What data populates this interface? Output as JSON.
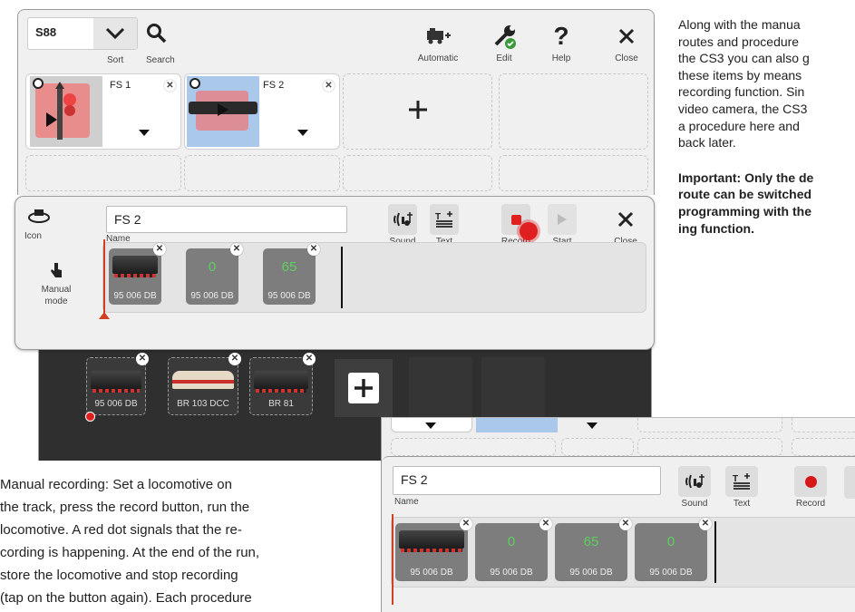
{
  "top_toolbar": {
    "s88_label": "S88",
    "sort_label": "Sort",
    "search_label": "Search",
    "automatic_label": "Automatic",
    "edit_label": "Edit",
    "help_label": "Help",
    "close_label": "Close"
  },
  "route_cards": [
    {
      "label": "FS 1"
    },
    {
      "label": "FS 2"
    }
  ],
  "editor": {
    "icon_label": "Icon",
    "name_value": "FS 2",
    "name_label": "Name",
    "sound_label": "Sound",
    "text_label": "Text",
    "record_label": "Record",
    "start_label": "Start",
    "close_label": "Close",
    "mode_label": "Manual mode",
    "steps": [
      {
        "caption": "95 006 DB",
        "value": ""
      },
      {
        "caption": "95 006 DB",
        "value": "0"
      },
      {
        "caption": "95 006 DB",
        "value": "65"
      }
    ]
  },
  "loco_list": [
    {
      "caption": "95 006 DB"
    },
    {
      "caption": "BR 103 DCC"
    },
    {
      "caption": "BR 81"
    }
  ],
  "zoom": {
    "name_value": "FS 2",
    "name_label": "Name",
    "sound_label": "Sound",
    "text_label": "Text",
    "record_label": "Record",
    "steps": [
      {
        "caption": "95 006 DB",
        "value": ""
      },
      {
        "caption": "95 006 DB",
        "value": "0"
      },
      {
        "caption": "95 006 DB",
        "value": "65"
      },
      {
        "caption": "95 006 DB",
        "value": "0"
      }
    ]
  },
  "text_right": {
    "para1": "Along with the manual routes and procedure the CS3 you can also g these items by means recording function. Sin video camera, the CS3 a procedure here and back later.",
    "lines1": [
      "Along with the manua",
      "routes and procedure",
      "the CS3 you can also g",
      "these items by means",
      "recording function. Sin",
      "video camera, the CS3",
      "a procedure here and",
      "back later."
    ],
    "lines2": [
      "Important: Only the de",
      "route can be switched",
      "programming with the",
      "ing function."
    ]
  },
  "text_bottom": {
    "lines": [
      "Manual recording: Set a locomotive on",
      "the track, press the record button, run the",
      "locomotive. A red dot signals that the re-",
      "cording is happening. At the end of the run,",
      "store the locomotive and stop recording",
      "(tap on the button again). Each procedure"
    ]
  },
  "colors": {
    "record_red": "#e02020",
    "accent_blue": "#9cc3ea",
    "value_green": "#5fd05f"
  }
}
